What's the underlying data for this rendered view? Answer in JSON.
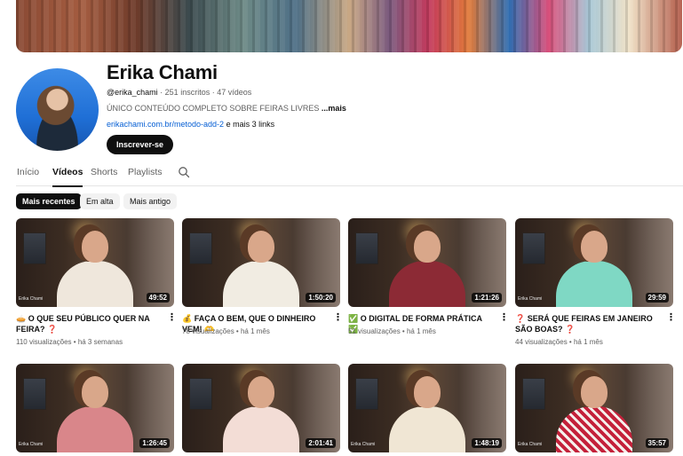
{
  "channel": {
    "name": "Erika Chami",
    "handle": "@erika_chami",
    "subscribers": "251 inscritos",
    "videos_count": "47 vídeos",
    "description": "ÚNICO CONTEÚDO COMPLETO SOBRE FEIRAS LIVRES",
    "description_more": "...mais",
    "link": "erikachami.com.br/metodo-add-2",
    "more_links": "e mais 3 links",
    "subscribe_label": "Inscrever-se"
  },
  "tabs": [
    {
      "label": "Início"
    },
    {
      "label": "Vídeos"
    },
    {
      "label": "Shorts"
    },
    {
      "label": "Playlists"
    }
  ],
  "filters": [
    {
      "label": "Mais recentes"
    },
    {
      "label": "Em alta"
    },
    {
      "label": "Mais antigo"
    }
  ],
  "videos": [
    {
      "title": "🥧 O QUE SEU PÚBLICO QUER NA FEIRA? ❓",
      "views": "110 visualizações",
      "age": "há 3 semanas",
      "duration": "49:52",
      "brand": "Erika Chami"
    },
    {
      "title": "💰 FAÇA O BEM, QUE O DINHEIRO VEM! 🫶",
      "views": "78 visualizações",
      "age": "há 1 mês",
      "duration": "1:50:20",
      "brand": ""
    },
    {
      "title": "✅ O DIGITAL DE FORMA PRÁTICA ✅",
      "views": "51 visualizações",
      "age": "há 1 mês",
      "duration": "1:21:26",
      "brand": ""
    },
    {
      "title": "❓ SERÁ QUE FEIRAS EM JANEIRO SÃO BOAS? ❓",
      "views": "44 visualizações",
      "age": "há 1 mês",
      "duration": "29:59",
      "brand": "Erika Chami"
    },
    {
      "title": "",
      "views": "",
      "age": "",
      "duration": "1:26:45",
      "brand": "Erika Chami"
    },
    {
      "title": "",
      "views": "",
      "age": "",
      "duration": "2:01:41",
      "brand": ""
    },
    {
      "title": "",
      "views": "",
      "age": "",
      "duration": "1:48:19",
      "brand": "Erika Chami"
    },
    {
      "title": "",
      "views": "",
      "age": "",
      "duration": "35:57",
      "brand": "Erika Chami"
    }
  ],
  "icons": {
    "search": "search-icon",
    "more": "more-vert-icon"
  },
  "colors": {
    "link": "#065fd4",
    "primary": "#0f0f0f",
    "secondary": "#606060"
  }
}
